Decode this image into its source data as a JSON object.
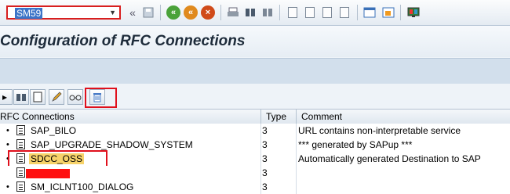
{
  "toolbar": {
    "command_field": "SM59",
    "icons": [
      "dropdown-icon",
      "double-left-icon",
      "save-icon",
      "back-icon",
      "exit-icon",
      "cancel-icon",
      "print-icon",
      "find-icon",
      "find-next-icon",
      "first-page-icon",
      "previous-page-icon",
      "next-page-icon",
      "last-page-icon",
      "create-session-icon",
      "shortcut-icon",
      "help-icon"
    ]
  },
  "header": {
    "title": "Configuration of RFC Connections"
  },
  "app_toolbar": {
    "icons": [
      "expand-icon",
      "search-icon",
      "create-icon",
      "change-icon",
      "glasses-icon",
      "delete-icon"
    ]
  },
  "table": {
    "headers": {
      "name": "RFC Connections",
      "type": "Type",
      "comment": "Comment"
    },
    "rows": [
      {
        "name": "SAP_BILO",
        "type": "3",
        "comment": "URL contains non-interpretable service"
      },
      {
        "name": "SAP_UPGRADE_SHADOW_SYSTEM",
        "type": "3",
        "comment": "*** generated by SAPup ***"
      },
      {
        "name": "SDCC_OSS",
        "type": "3",
        "comment": "Automatically generated Destination to SAP"
      },
      {
        "name": "",
        "type": "3",
        "comment": ""
      },
      {
        "name": "SM_ICLNT100_DIALOG",
        "type": "3",
        "comment": ""
      }
    ]
  },
  "colors": {
    "highlight_red": "#e0101c",
    "selection": "#f7d36a",
    "command_selection": "#3b74c8"
  }
}
